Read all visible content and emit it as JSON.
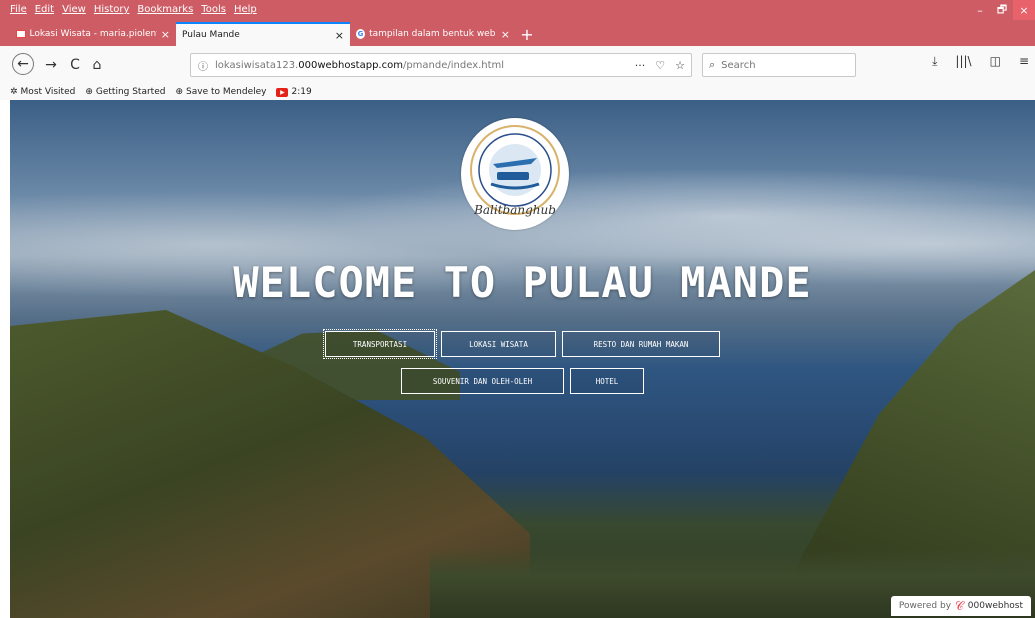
{
  "menubar": [
    "File",
    "Edit",
    "View",
    "History",
    "Bookmarks",
    "Tools",
    "Help"
  ],
  "window_controls": {
    "minimize": "–",
    "restore": "🗗",
    "close": "×"
  },
  "tabs": [
    {
      "title": "Lokasi Wisata - maria.piolenta",
      "close": "×",
      "favicon": "gmail-icon"
    },
    {
      "title": "Pulau Mande",
      "close": "×"
    },
    {
      "title": "tampilan dalam bentuk web - P",
      "close": "×",
      "favicon": "google-icon"
    }
  ],
  "new_tab": "+",
  "toolbar": {
    "back": "←",
    "forward": "→",
    "reload": "C",
    "home": "⌂"
  },
  "url": {
    "info": "ⓘ",
    "prefix": "lokasiwisata123.",
    "host": "000webhostapp.com",
    "path": "/pmande/index.html"
  },
  "url_icons": {
    "more": "···",
    "pocket": "♡",
    "star": "☆"
  },
  "search": {
    "placeholder": "Search",
    "icon": "⌕"
  },
  "right_tools": {
    "download": "⤓",
    "library": "|||\\",
    "sidebar": "◫",
    "menu": "≡"
  },
  "bookmarks": [
    "Most Visited",
    "Getting Started",
    "Save to Mendeley",
    "2:19"
  ],
  "page": {
    "logo_text": "Balitbanghub",
    "heading": "WELCOME TO PULAU MANDE",
    "nav_row1": [
      "TRANSPORTASI",
      "LOKASI WISATA",
      "RESTO DAN RUMAH MAKAN"
    ],
    "nav_row2": [
      "SOUVENIR DAN OLEH-OLEH",
      "HOTEL"
    ],
    "powered_label": "Powered by",
    "powered_brand": "000webhost"
  }
}
